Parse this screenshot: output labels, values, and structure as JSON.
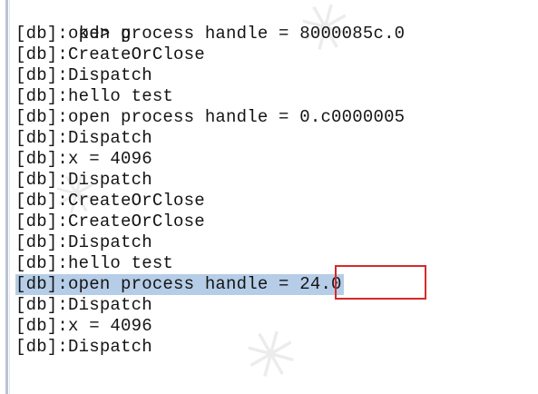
{
  "console": {
    "prompt_line": "kd> g",
    "lines": [
      "[db]:open process handle = 8000085c.0",
      "[db]:CreateOrClose",
      "[db]:Dispatch",
      "[db]:hello test",
      "[db]:open process handle = 0.c0000005",
      "[db]:Dispatch",
      "[db]:x = 4096",
      "[db]:Dispatch",
      "[db]:CreateOrClose",
      "[db]:CreateOrClose",
      "[db]:Dispatch",
      "[db]:hello test",
      "[db]:open process handle = 24.0",
      "[db]:Dispatch",
      "[db]:x = 4096",
      "[db]:Dispatch"
    ],
    "highlighted_line_index": 12
  },
  "colors": {
    "selection": "#b6cde7",
    "annotation_box": "#d42a2a",
    "text": "#141414"
  }
}
